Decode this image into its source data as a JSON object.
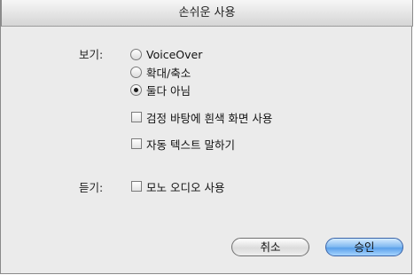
{
  "window": {
    "title": "손쉬운 사용"
  },
  "view": {
    "label": "보기:",
    "options": [
      {
        "label": "VoiceOver",
        "selected": false
      },
      {
        "label": "확대/축소",
        "selected": false
      },
      {
        "label": "둘다 아님",
        "selected": true
      }
    ],
    "checkboxes": [
      {
        "label": "검정 바탕에 흰색 화면 사용",
        "checked": false
      },
      {
        "label": "자동 텍스트 말하기",
        "checked": false
      }
    ]
  },
  "hearing": {
    "label": "듣기:",
    "checkbox": {
      "label": "모노 오디오 사용",
      "checked": false
    }
  },
  "buttons": {
    "cancel": "취소",
    "ok": "승인"
  }
}
